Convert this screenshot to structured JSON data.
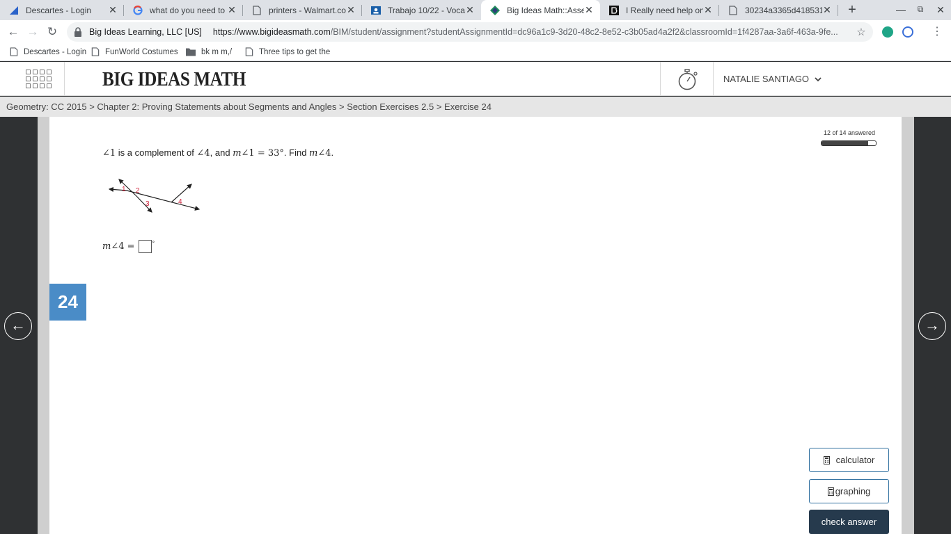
{
  "browser": {
    "tabs": [
      {
        "title": "Descartes - Login",
        "icon": "descartes-icon",
        "active": false
      },
      {
        "title": "what do you need to m",
        "icon": "google-icon",
        "active": false
      },
      {
        "title": "printers - Walmart.com",
        "icon": "page-icon",
        "active": false
      },
      {
        "title": "Trabajo 10/22 - Vocab",
        "icon": "classroom-icon",
        "active": false
      },
      {
        "title": "Big Ideas Math::Assess",
        "icon": "bigideas-icon",
        "active": true
      },
      {
        "title": "I Really need help on th",
        "icon": "brainly-icon",
        "active": false
      },
      {
        "title": "30234a3365d418531c",
        "icon": "page-icon",
        "active": false
      }
    ],
    "site_identity": "Big Ideas Learning, LLC [US]",
    "url_host": "https://www.bigideasmath.com",
    "url_path": "/BIM/student/assignment?studentAssignmentId=dc96a1c9-3d20-48c2-8e52-c3b05ad4a2f2&classroomId=1f4287aa-3a6f-463a-9fe...",
    "bookmarks": [
      {
        "label": "Descartes - Login",
        "icon": "page-icon"
      },
      {
        "label": "FunWorld Costumes",
        "icon": "page-icon"
      },
      {
        "label": "bk m m,/",
        "icon": "folder-icon"
      },
      {
        "label": "Three tips to get the",
        "icon": "page-icon"
      }
    ]
  },
  "site": {
    "logo": "BIG IDEAS MATH",
    "user_name": "NATALIE SANTIAGO",
    "breadcrumb": "Geometry: CC 2015 > Chapter 2: Proving Statements about Segments and Angles > Section Exercises 2.5 > Exercise 24"
  },
  "exercise": {
    "number": "24",
    "progress_label": "12 of 14 answered",
    "progress_fraction": 0.857,
    "question": {
      "a1": "∠1",
      "t1": " is a complement of ",
      "a4": "∠4",
      "t2": ", and ",
      "m": "m",
      "a1b": "∠1",
      "eq": " = 33°",
      "t3": ". Find ",
      "m2": "m",
      "a4b": "∠4",
      "t4": "."
    },
    "figure_labels": [
      "1",
      "2",
      "3",
      "4"
    ],
    "answer_m": "m",
    "answer_prompt": "∠4 =",
    "degree": "°"
  },
  "tools": {
    "calculator": "calculator",
    "graphing": "graphing",
    "check_answer": "check answer"
  },
  "colors": {
    "exercise_badge": "#4a8cc7",
    "check_button": "#263a4d",
    "figure_labels": "#d0233c"
  }
}
